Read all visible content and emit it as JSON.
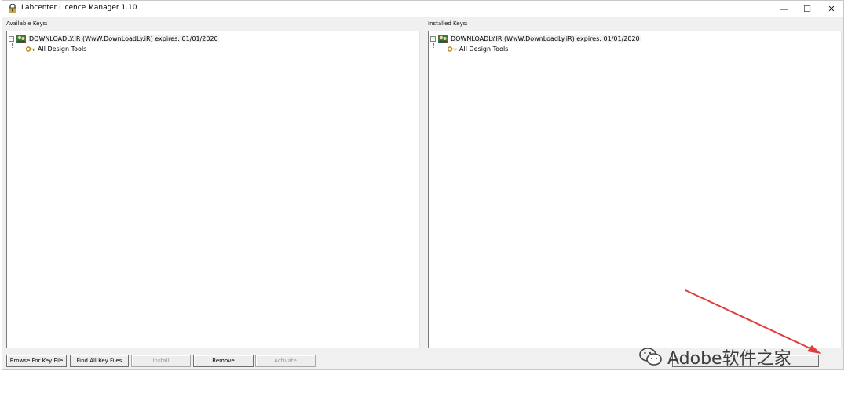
{
  "window": {
    "title": "Labcenter Licence Manager 1.10",
    "controls": {
      "minimize": "—",
      "maximize": "☐",
      "close": "✕"
    }
  },
  "available": {
    "label": "Available Keys:",
    "root_text": "DOWNLOADLY.IR (WwW.DownLoadLy.iR) expires: 01/01/2020",
    "child_text": "All Design Tools",
    "expander": "−"
  },
  "installed": {
    "label": "Installed Keys:",
    "root_text": "DOWNLOADLY.IR (WwW.DownLoadLy.iR) expires: 01/01/2020",
    "child_text": "All Design Tools",
    "expander": "−"
  },
  "buttons": {
    "browse": "Browse For Key File",
    "find_all": "Find All Key Files",
    "install": "Install",
    "remove": "Remove",
    "activate": "Activate"
  },
  "watermark": {
    "text": "Adobe软件之家"
  },
  "colors": {
    "window_bg": "#f0f0f0",
    "arrow": "#e23b3b"
  }
}
